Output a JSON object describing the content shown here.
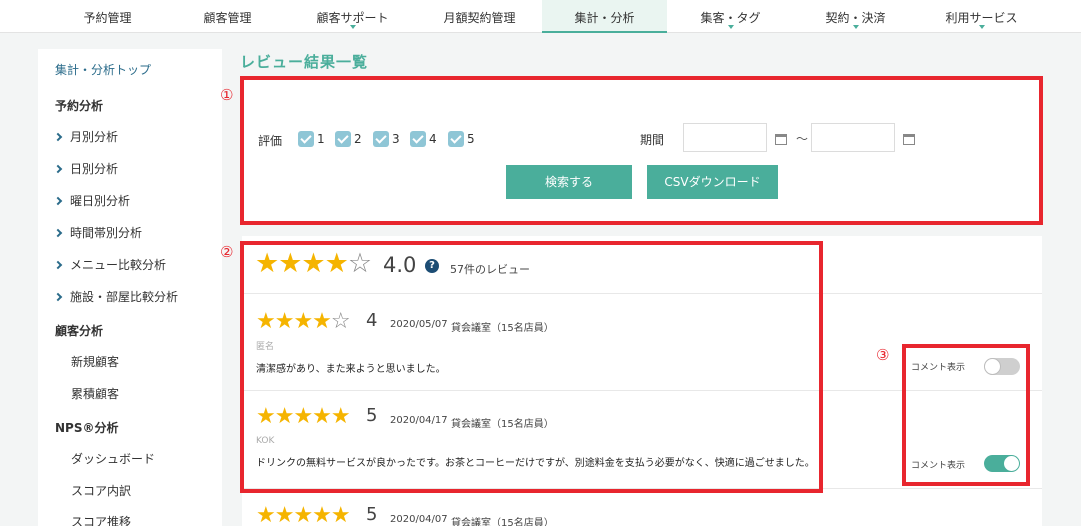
{
  "nav": {
    "items": [
      {
        "label": "予約管理",
        "caret": false
      },
      {
        "label": "顧客管理",
        "caret": false
      },
      {
        "label": "顧客サポート",
        "caret": true
      },
      {
        "label": "月額契約管理",
        "caret": false
      },
      {
        "label": "集計・分析",
        "caret": false,
        "active": true
      },
      {
        "label": "集客・タグ",
        "caret": true
      },
      {
        "label": "契約・決済",
        "caret": true
      },
      {
        "label": "利用サービス",
        "caret": true
      }
    ]
  },
  "sidebar": {
    "top_link": "集計・分析トップ",
    "sections": [
      {
        "heading": "予約分析",
        "items": [
          "月別分析",
          "日別分析",
          "曜日別分析",
          "時間帯別分析",
          "メニュー比較分析",
          "施設・部屋比較分析"
        ]
      },
      {
        "heading": "顧客分析",
        "items": [
          "新規顧客",
          "累積顧客"
        ]
      },
      {
        "heading": "NPS®分析",
        "items": [
          "ダッシュボード",
          "スコア内訳",
          "スコア推移"
        ]
      }
    ]
  },
  "page": {
    "title": "レビュー結果一覧"
  },
  "filter": {
    "rating_label": "評価",
    "ratings": [
      "1",
      "2",
      "3",
      "4",
      "5"
    ],
    "period_label": "期間",
    "date_from": "",
    "date_to": "",
    "tilde": "～",
    "search_button": "検索する",
    "csv_button": "CSVダウンロード"
  },
  "summary": {
    "stars_filled": 4,
    "stars_total": 5,
    "average": "4.0",
    "help": "?",
    "count": "57件のレビュー"
  },
  "reviews": [
    {
      "score": "4",
      "stars_filled": 4,
      "date": "2020/05/07",
      "store": "貸会議室（15名店員）",
      "name": "匿名",
      "comment": "清潔感があり、また来ようと思いました。",
      "toggle_label": "コメント表示",
      "toggle_on": false
    },
    {
      "score": "5",
      "stars_filled": 5,
      "date": "2020/04/17",
      "store": "貸会議室（15名店員）",
      "name": "KOK",
      "comment": "ドリンクの無料サービスが良かったです。お茶とコーヒーだけですが、別途料金を支払う必要がなく、快適に過ごせました。",
      "toggle_label": "コメント表示",
      "toggle_on": true
    },
    {
      "score": "5",
      "stars_filled": 5,
      "date": "2020/04/07",
      "store": "貸会議室（15名店員）"
    }
  ],
  "annotations": [
    "①",
    "②",
    "③"
  ],
  "colors": {
    "accent": "#4aae9b",
    "star": "#f5b400",
    "annotation": "#e8262e"
  }
}
